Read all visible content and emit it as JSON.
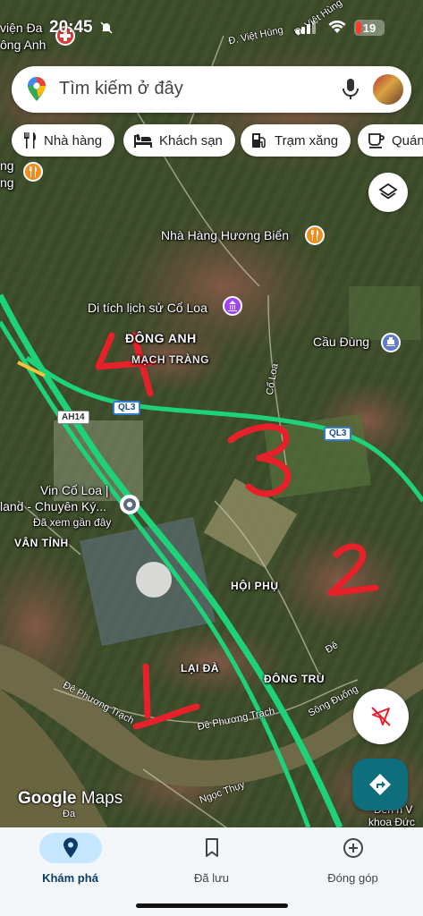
{
  "status_bar": {
    "time": "20:45",
    "battery": "19"
  },
  "search": {
    "placeholder": "Tìm kiếm ở đây"
  },
  "chips": [
    {
      "label": "Nhà hàng",
      "icon": "fork-knife-icon"
    },
    {
      "label": "Khách sạn",
      "icon": "bed-icon"
    },
    {
      "label": "Trạm xăng",
      "icon": "gas-station-icon"
    },
    {
      "label": "Quán",
      "icon": "coffee-icon"
    }
  ],
  "map": {
    "places": {
      "library_line1": "viện Đa",
      "library_line2": "ông Anh",
      "nha_hang_huong_bien": "Nhà Hàng Hương Biển",
      "di_tich": "Di tích lịch sử Cổ Loa",
      "dong_anh": "ĐÔNG ANH",
      "mach_trang": "MẠCH TRÀNG",
      "cau_dung": "Cầu Đùng",
      "vin_line1": "Vin Cổ Loa |",
      "vin_line2": "land - Chuyên Ký...",
      "vin_line3": "Đã xem gần đây",
      "van_tinh": "VÂN TỈNH",
      "hoi_phu": "HỘI PHỤ",
      "lai_da": "LẠI ĐÀ",
      "dong_tru": "ĐÔNG TRÙ",
      "left_poi_line1": "ng",
      "left_poi_line2": "ng",
      "denh_line1": "Đền h V",
      "denh_line2": "khoa Đức"
    },
    "roads": {
      "viet_hung_1": "Đ. Việt Hùng",
      "viet_hung_2": "Đ. Việt Hùng",
      "co_loa": "Cổ Loa",
      "de_phuong_trach_1": "Đê Phương Trạch",
      "de_phuong_trach_2": "Đê Phương Trạch",
      "song_duong": "Sông Đuống",
      "ngoc_thuy": "Ngọc Thụy",
      "de": "Đê",
      "da": "Đa"
    },
    "shields": {
      "ql3_a": "QL3",
      "ql3_b": "QL3",
      "ah14": "AH14"
    },
    "annotations": [
      "1",
      "2",
      "3",
      "4"
    ]
  },
  "logo": {
    "google": "Google",
    "maps": "Maps"
  },
  "bottom_nav": [
    {
      "label": "Khám phá",
      "icon": "location-pin-icon",
      "active": true
    },
    {
      "label": "Đã lưu",
      "icon": "bookmark-icon",
      "active": false
    },
    {
      "label": "Đóng góp",
      "icon": "add-circle-icon",
      "active": false
    }
  ],
  "colors": {
    "highway": "#1ed27a",
    "annotation": "#e8202a",
    "poi_food": "#f08c1e",
    "poi_landmark": "#a142f4",
    "poi_transit": "#5f7bc9",
    "directions_fab": "#0e6e7c"
  }
}
